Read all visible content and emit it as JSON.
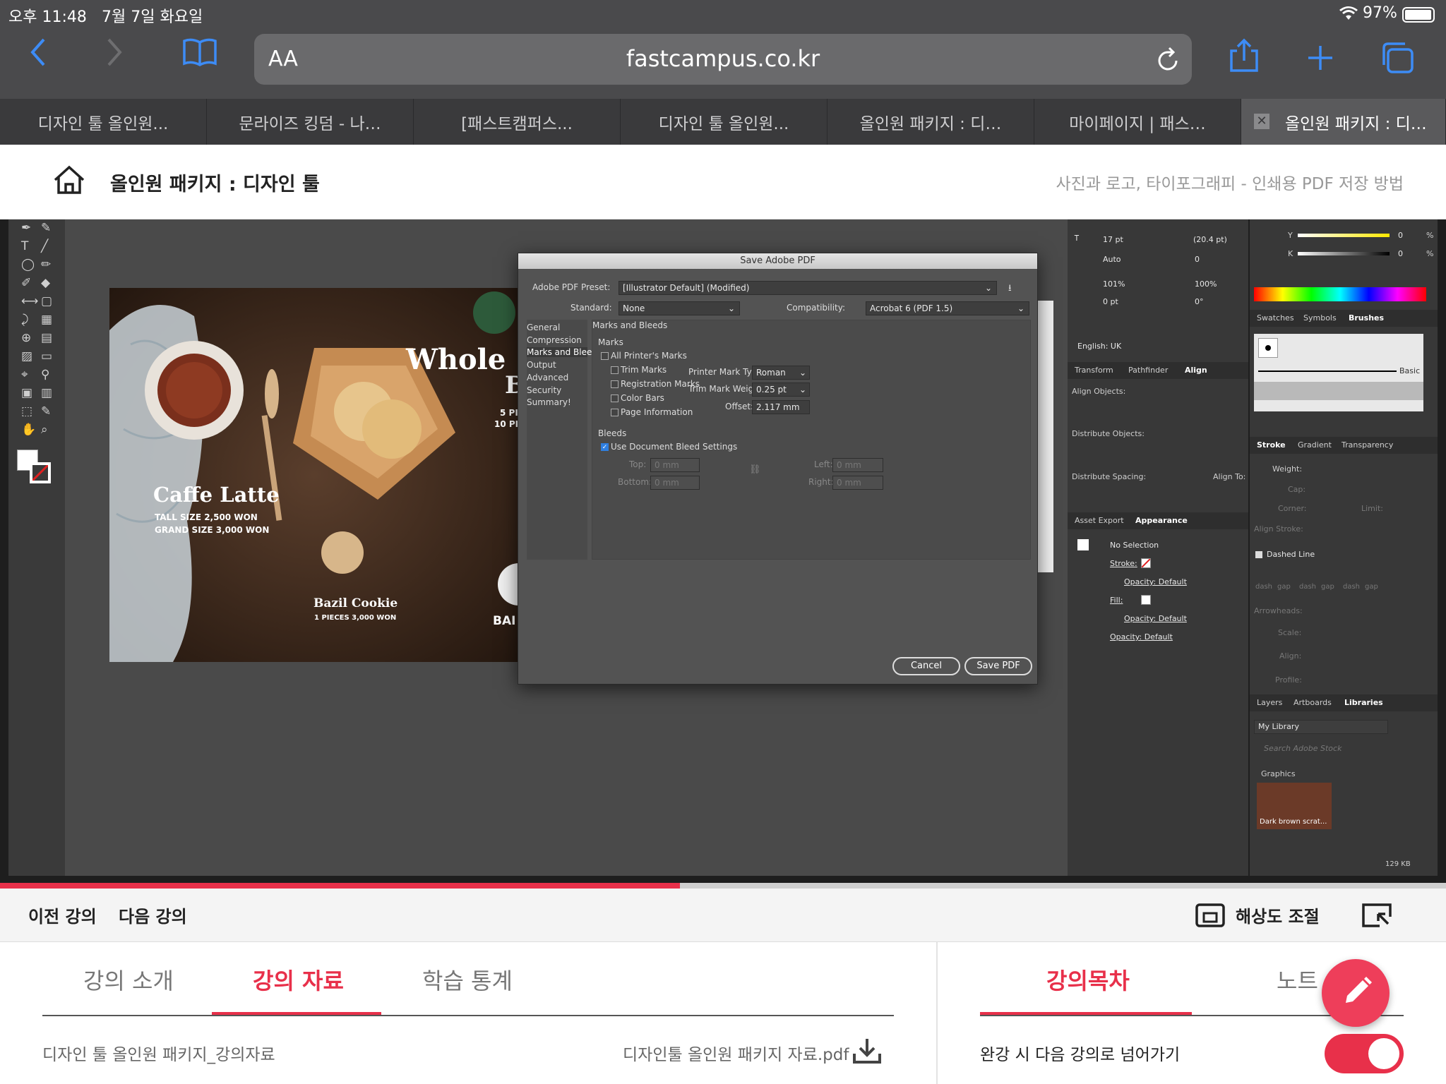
{
  "status": {
    "time": "오후 11:48",
    "date": "7월 7일 화요일",
    "battery": "97%"
  },
  "safari": {
    "text_size": "AA",
    "url": "fastcampus.co.kr",
    "tabs": [
      "디자인 툴 올인원...",
      "문라이즈 킹덤 - 나…",
      "[패스트캠퍼스...",
      "디자인 툴 올인원...",
      "올인원 패키지 : 디…",
      "마이페이지 | 패스…",
      "올인원 패키지 : 디…"
    ]
  },
  "header": {
    "course_title": "올인원 패키지 : 디자인 툴",
    "lecture_title": "사진과 로고, 타이포그래피 - 인쇄용 PDF 저장 방법"
  },
  "artboard": {
    "headline": "Whole",
    "headline2": "B",
    "line1": "5 PI",
    "line2": "10 PI",
    "caffe": "Caffe Latte",
    "tall": "TALL SIZE 2,500 WON",
    "grand": "GRAND SIZE 3,000 WON",
    "cookie": "Bazil Cookie",
    "cookie_price": "1 PIECES 3,000 WON",
    "bai": "BAI"
  },
  "dialog": {
    "title": "Save Adobe PDF",
    "preset_label": "Adobe PDF Preset:",
    "preset_value": "[Illustrator Default] (Modified)",
    "standard_label": "Standard:",
    "standard_value": "None",
    "compat_label": "Compatibility:",
    "compat_value": "Acrobat 6 (PDF 1.5)",
    "sidebar": [
      "General",
      "Compression",
      "Marks and Bleeds",
      "Output",
      "Advanced",
      "Security",
      "Summary!"
    ],
    "section_title": "Marks and Bleeds",
    "marks_group": "Marks",
    "all_printers": "All Printer's Marks",
    "trim": "Trim Marks",
    "registration": "Registration Marks",
    "color_bars": "Color Bars",
    "page_info": "Page Information",
    "mark_type_label": "Printer Mark Type:",
    "mark_type_value": "Roman",
    "mark_weight_label": "Trim Mark Weight:",
    "mark_weight_value": "0.25 pt",
    "offset_label": "Offset:",
    "offset_value": "2.117 mm",
    "bleeds_group": "Bleeds",
    "use_bleed": "Use Document Bleed Settings",
    "top": "Top:",
    "bottom": "Bottom:",
    "left": "Left:",
    "right": "Right:",
    "bleed_value": "0 mm",
    "cancel": "Cancel",
    "save": "Save PDF"
  },
  "panels": {
    "font_size": "17 pt",
    "leading": "(20.4 pt)",
    "kerning": "Auto",
    "tracking": "0",
    "vscale": "101%",
    "hscale": "100%",
    "baseline": "0 pt",
    "rotate": "0°",
    "language": "English: UK",
    "tabs_transform": [
      "Transform",
      "Pathfinder",
      "Align"
    ],
    "align_objects": "Align Objects:",
    "distribute_objects": "Distribute Objects:",
    "distribute_spacing": "Distribute Spacing:",
    "align_to": "Align To:",
    "tabs_appearance": [
      "Asset Export",
      "Appearance"
    ],
    "no_selection": "No Selection",
    "stroke": "Stroke:",
    "fill": "Fill:",
    "opacity_default": "Opacity: Default",
    "swatch_tabs": [
      "Swatches",
      "Symbols",
      "Brushes"
    ],
    "basic": "Basic",
    "stroke_tabs": [
      "Stroke",
      "Gradient",
      "Transparency"
    ],
    "weight": "Weight:",
    "cap": "Cap:",
    "corner": "Corner:",
    "limit": "Limit:",
    "align_stroke": "Align Stroke:",
    "dashed_line": "Dashed Line",
    "dash_labels": [
      "dash",
      "gap",
      "dash",
      "gap",
      "dash",
      "gap"
    ],
    "arrowheads": "Arrowheads:",
    "scale": "Scale:",
    "align": "Align:",
    "profile": "Profile:",
    "lib_tabs": [
      "Layers",
      "Artboards",
      "Libraries"
    ],
    "my_library": "My Library",
    "search_stock": "Search Adobe Stock",
    "graphics": "Graphics",
    "thumb_label": "Dark brown scrat...",
    "file_size": "129 KB",
    "y_label": "Y",
    "k_label": "K",
    "y_value": "0",
    "k_value": "0",
    "pct": "%"
  },
  "video": {
    "progress": 0.47
  },
  "controls": {
    "prev": "이전 강의",
    "next": "다음 강의",
    "resolution": "해상도 조절"
  },
  "content_tabs": [
    "강의 소개",
    "강의 자료",
    "학습 통계"
  ],
  "materials": {
    "title": "디자인 툴 올인원 패키지_강의자료",
    "file": "디자인툴 올인원 패키지 자료.pdf"
  },
  "right_tabs": [
    "강의목차",
    "노트"
  ],
  "autoplay_label": "완강 시 다음 강의로 넘어가기",
  "autoplay_on": true,
  "colors": {
    "accent": "#e8304a",
    "ios_blue": "#3d8cf6"
  }
}
